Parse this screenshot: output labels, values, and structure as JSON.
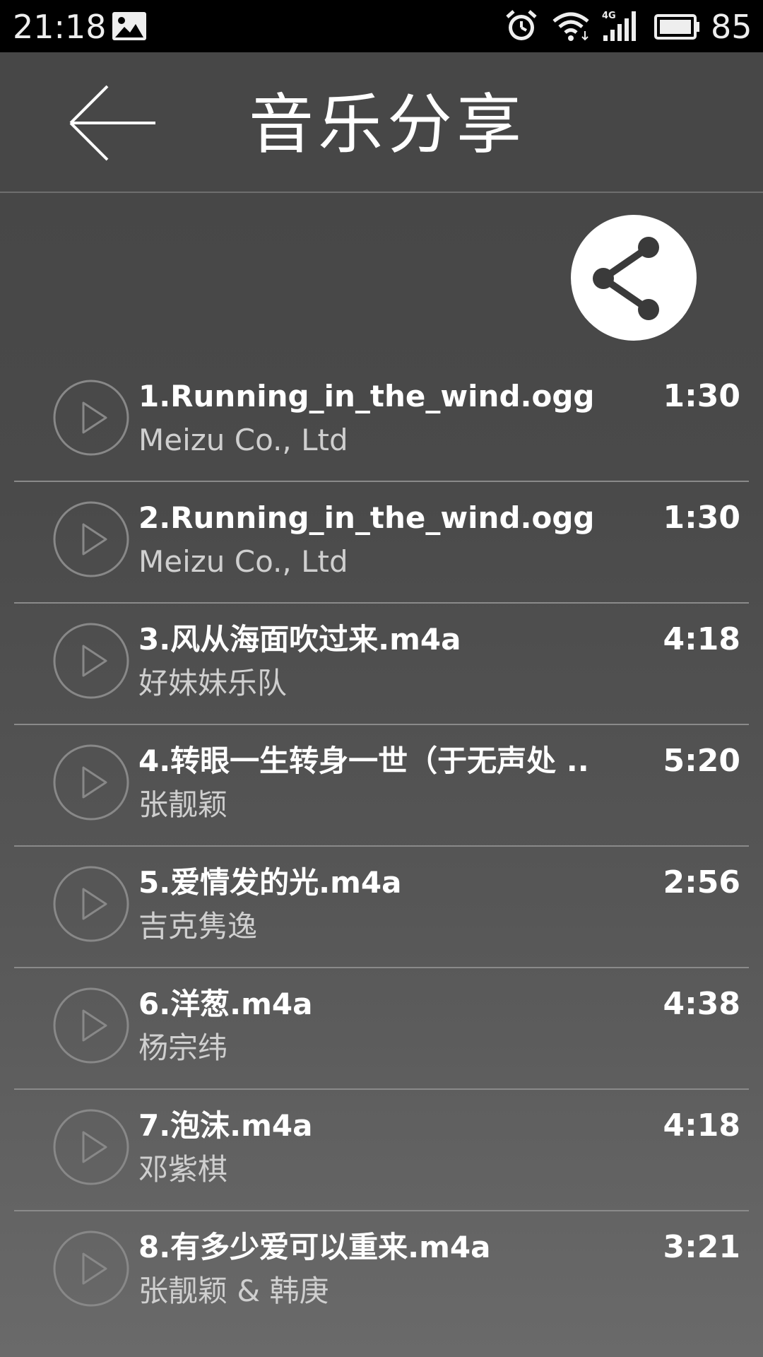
{
  "status_bar": {
    "time": "21:18",
    "battery": "85",
    "icons": [
      "image-icon",
      "alarm-icon",
      "wifi-icon",
      "4g-signal-icon",
      "battery-icon"
    ]
  },
  "header": {
    "title": "音乐分享",
    "back_icon": "arrow-left-icon"
  },
  "share": {
    "icon": "share-icon"
  },
  "tracks": [
    {
      "title": "1.Running_in_the_wind.ogg",
      "artist": "Meizu Co., Ltd",
      "duration": "1:30"
    },
    {
      "title": "2.Running_in_the_wind.ogg",
      "artist": "Meizu Co., Ltd",
      "duration": "1:30"
    },
    {
      "title": "3.风从海面吹过来.m4a",
      "artist": "好妹妹乐队",
      "duration": "4:18"
    },
    {
      "title": "4.转眼一生转身一世（于无声处 ..",
      "artist": "张靓颖",
      "duration": "5:20"
    },
    {
      "title": "5.爱情发的光.m4a",
      "artist": "吉克隽逸",
      "duration": "2:56"
    },
    {
      "title": "6.洋葱.m4a",
      "artist": "杨宗纬",
      "duration": "4:38"
    },
    {
      "title": "7.泡沫.m4a",
      "artist": "邓紫棋",
      "duration": "4:18"
    },
    {
      "title": "8.有多少爱可以重来.m4a",
      "artist": "张靓颖 & 韩庚",
      "duration": "3:21"
    }
  ]
}
